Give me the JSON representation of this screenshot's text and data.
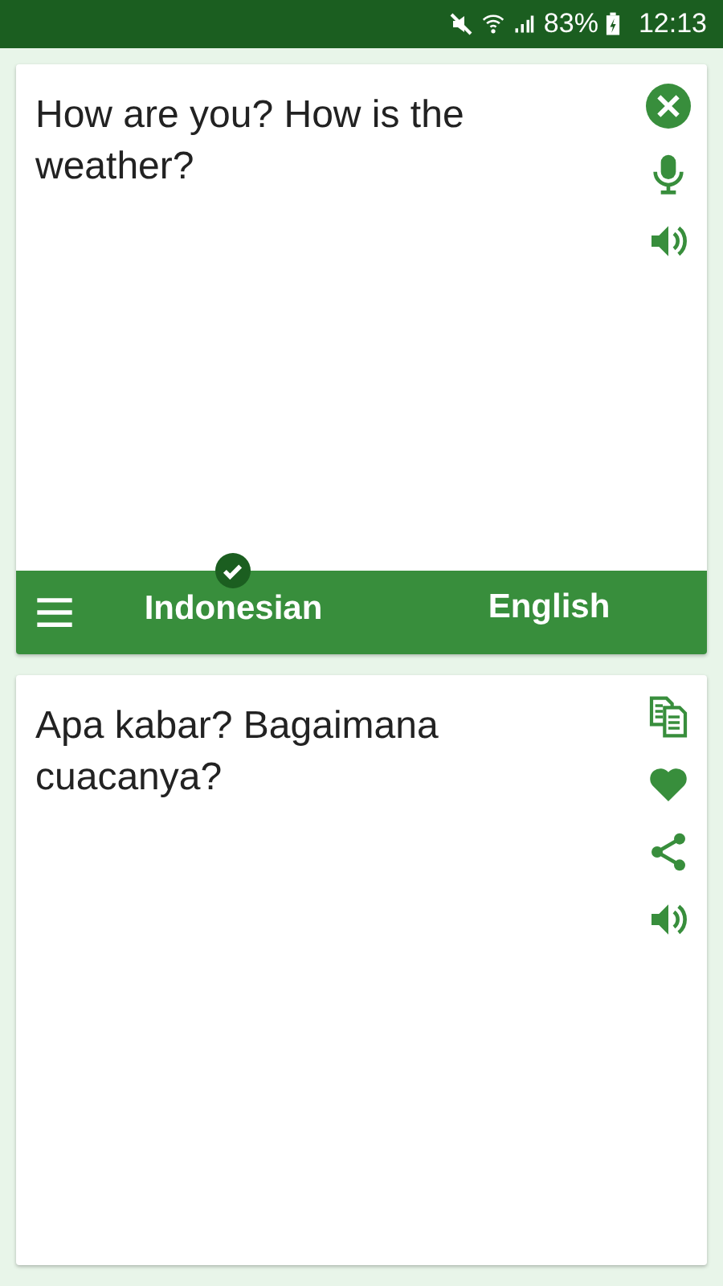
{
  "status_bar": {
    "battery": "83%",
    "time": "12:13"
  },
  "source": {
    "text": "How are you? How is the weather?"
  },
  "language_bar": {
    "languages": [
      {
        "label": "Indonesian",
        "selected": true
      },
      {
        "label": "English",
        "selected": false
      }
    ]
  },
  "result": {
    "text": "Apa kabar? Bagaimana cuacanya?"
  }
}
